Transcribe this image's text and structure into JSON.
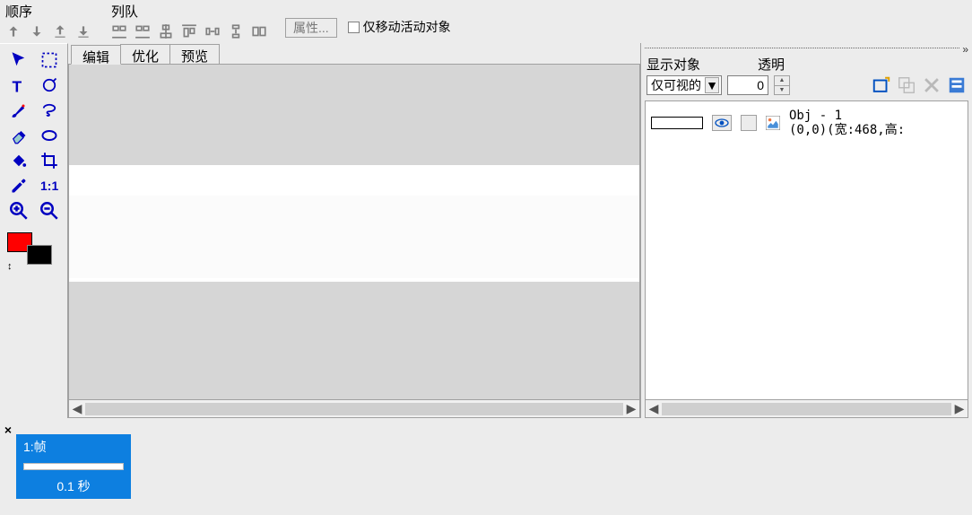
{
  "toolbar": {
    "order_group_label": "顺序",
    "queue_group_label": "列队",
    "properties_button": "属性...",
    "move_active_only": "仅移动活动对象"
  },
  "tabs": {
    "edit": "编辑",
    "optimize": "优化",
    "preview": "预览"
  },
  "right_panel": {
    "display_label": "显示对象",
    "transparency_label": "透明",
    "visibility_options_selected": "仅可视的",
    "transparency_value": "0"
  },
  "object": {
    "name": "Obj - 1",
    "info": "(0,0)(宽:468,高:"
  },
  "frame": {
    "title": "1:帧",
    "time": "0.1 秒"
  }
}
